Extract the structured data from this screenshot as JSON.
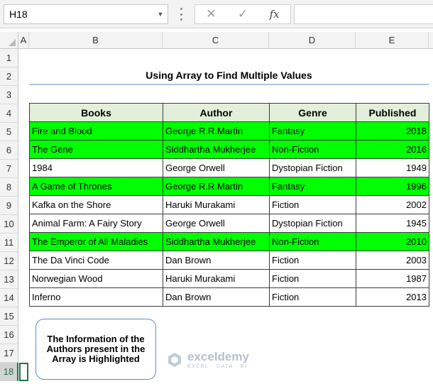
{
  "formula_bar": {
    "name_box": "H18",
    "formula": ""
  },
  "icons": {
    "cancel": "✕",
    "enter": "✓",
    "function": "fx",
    "dropdown": "▼"
  },
  "columns": [
    "A",
    "B",
    "C",
    "D",
    "E"
  ],
  "rows": [
    "1",
    "2",
    "3",
    "4",
    "5",
    "6",
    "7",
    "8",
    "9",
    "10",
    "11",
    "12",
    "13",
    "14",
    "15",
    "16",
    "17",
    "18"
  ],
  "active_row": "18",
  "sheet": {
    "title": "Using Array to Find Multiple Values",
    "headers": [
      "Books",
      "Author",
      "Genre",
      "Published"
    ],
    "records": [
      {
        "book": "Fire and Blood",
        "author": "George R.R.Martin",
        "genre": "Fantasy",
        "published": "2018",
        "highlighted": true
      },
      {
        "book": "The Gene",
        "author": "Siddhartha Mukherjee",
        "genre": "Non-Fiction",
        "published": "2016",
        "highlighted": true
      },
      {
        "book": "1984",
        "author": "George Orwell",
        "genre": "Dystopian Fiction",
        "published": "1949",
        "highlighted": false
      },
      {
        "book": "A Game of Thrones",
        "author": "George R.R.Martin",
        "genre": "Fantasy",
        "published": "1996",
        "highlighted": true
      },
      {
        "book": "Kafka on the Shore",
        "author": "Haruki Murakami",
        "genre": "Fiction",
        "published": "2002",
        "highlighted": false
      },
      {
        "book": "Animal Farm: A Fairy Story",
        "author": "George Orwell",
        "genre": "Dystopian Fiction",
        "published": "1945",
        "highlighted": false
      },
      {
        "book": "The Emperor of All Maladies",
        "author": "Siddhartha Mukherjee",
        "genre": "Non-Fiction",
        "published": "2010",
        "highlighted": true
      },
      {
        "book": "The Da Vinci Code",
        "author": "Dan Brown",
        "genre": "Fiction",
        "published": "2003",
        "highlighted": false
      },
      {
        "book": "Norwegian Wood",
        "author": "Haruki Murakami",
        "genre": "Fiction",
        "published": "1987",
        "highlighted": false
      },
      {
        "book": "Inferno",
        "author": "Dan Brown",
        "genre": "Fiction",
        "published": "2013",
        "highlighted": false
      }
    ],
    "note": "The Information of the Authors present in the Array is Highlighted"
  },
  "watermark": {
    "name": "exceldemy",
    "tagline": "EXCEL · DATA · BI"
  },
  "colors": {
    "highlight": "#00ff00",
    "header_fill": "#e2efda",
    "title_rule": "#a9c4de",
    "selection": "#217346"
  }
}
